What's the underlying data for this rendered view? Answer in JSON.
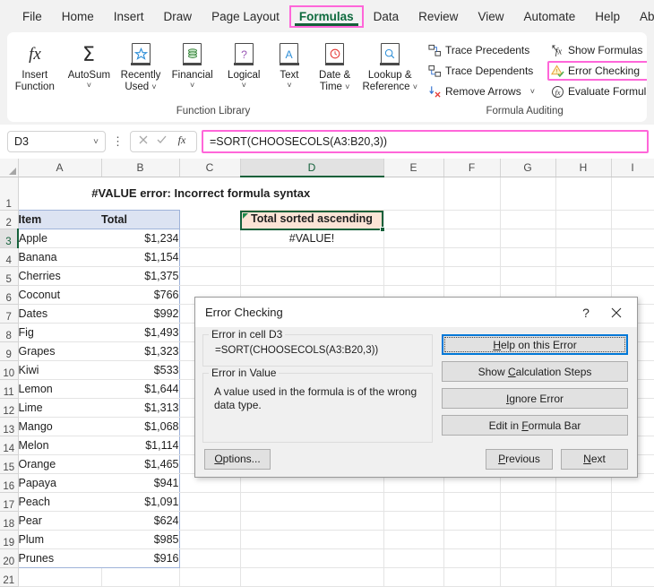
{
  "ribbon": {
    "tabs": [
      {
        "label": "File",
        "active": false
      },
      {
        "label": "Home",
        "active": false
      },
      {
        "label": "Insert",
        "active": false
      },
      {
        "label": "Draw",
        "active": false
      },
      {
        "label": "Page Layout",
        "active": false
      },
      {
        "label": "Formulas",
        "active": true
      },
      {
        "label": "Data",
        "active": false
      },
      {
        "label": "Review",
        "active": false
      },
      {
        "label": "View",
        "active": false
      },
      {
        "label": "Automate",
        "active": false
      },
      {
        "label": "Help",
        "active": false
      },
      {
        "label": "Ablebits",
        "active": false
      }
    ],
    "groups": {
      "function_library": {
        "label": "Function Library",
        "buttons": [
          {
            "line1": "Insert",
            "line2": "Function",
            "icon": "fx-icon",
            "dropdown": false
          },
          {
            "line1": "AutoSum",
            "line2": "",
            "icon": "sigma-icon",
            "dropdown": true
          },
          {
            "line1": "Recently",
            "line2": "Used",
            "icon": "star-book-icon",
            "dropdown": true
          },
          {
            "line1": "Financial",
            "line2": "",
            "icon": "coins-book-icon",
            "dropdown": true
          },
          {
            "line1": "Logical",
            "line2": "",
            "icon": "question-book-icon",
            "dropdown": true
          },
          {
            "line1": "Text",
            "line2": "",
            "icon": "letter-a-book-icon",
            "dropdown": true
          },
          {
            "line1": "Date &",
            "line2": "Time",
            "icon": "clock-book-icon",
            "dropdown": true
          },
          {
            "line1": "Lookup &",
            "line2": "Reference",
            "icon": "magnifier-book-icon",
            "dropdown": true
          }
        ]
      },
      "formula_auditing": {
        "label": "Formula Auditing",
        "col1": [
          {
            "label": "Trace Precedents",
            "icon": "trace-precedents-icon",
            "dropdown": false,
            "highlight": false
          },
          {
            "label": "Trace Dependents",
            "icon": "trace-dependents-icon",
            "dropdown": false,
            "highlight": false
          },
          {
            "label": "Remove Arrows",
            "icon": "remove-arrows-icon",
            "dropdown": true,
            "highlight": false
          }
        ],
        "col2": [
          {
            "label": "Show Formulas",
            "icon": "show-formulas-icon",
            "dropdown": false,
            "highlight": false
          },
          {
            "label": "Error Checking",
            "icon": "error-checking-icon",
            "dropdown": true,
            "highlight": true
          },
          {
            "label": "Evaluate Formula",
            "icon": "evaluate-formula-icon",
            "dropdown": false,
            "highlight": false
          }
        ]
      }
    }
  },
  "formula_bar": {
    "name_box_value": "D3",
    "name_box_chevron": "chevron-down-icon",
    "cancel_icon": "cancel-x-icon",
    "enter_icon": "enter-check-icon",
    "function_icon": "fx-icon",
    "formula_value": "=SORT(CHOOSECOLS(A3:B20,3))"
  },
  "grid": {
    "columns": [
      "A",
      "B",
      "C",
      "D",
      "E",
      "F",
      "G",
      "H",
      "I"
    ],
    "selected_column": "D",
    "selected_row": 3,
    "rows": [
      "1",
      "2",
      "3",
      "4",
      "5",
      "6",
      "7",
      "8",
      "9",
      "10",
      "11",
      "12",
      "13",
      "14",
      "15",
      "16",
      "17",
      "18",
      "19",
      "20",
      "21"
    ],
    "title": "#VALUE error: Incorrect formula syntax",
    "headers": {
      "a": "Item",
      "b": "Total",
      "d": "Total sorted ascending"
    },
    "data": [
      {
        "row": "3",
        "item": "Apple",
        "total": "$1,234"
      },
      {
        "row": "4",
        "item": "Banana",
        "total": "$1,154"
      },
      {
        "row": "5",
        "item": "Cherries",
        "total": "$1,375"
      },
      {
        "row": "6",
        "item": "Coconut",
        "total": "$766"
      },
      {
        "row": "7",
        "item": "Dates",
        "total": "$992"
      },
      {
        "row": "8",
        "item": "Fig",
        "total": "$1,493"
      },
      {
        "row": "9",
        "item": "Grapes",
        "total": "$1,323"
      },
      {
        "row": "10",
        "item": "Kiwi",
        "total": "$533"
      },
      {
        "row": "11",
        "item": "Lemon",
        "total": "$1,644"
      },
      {
        "row": "12",
        "item": "Lime",
        "total": "$1,313"
      },
      {
        "row": "13",
        "item": "Mango",
        "total": "$1,068"
      },
      {
        "row": "14",
        "item": "Melon",
        "total": "$1,114"
      },
      {
        "row": "15",
        "item": "Orange",
        "total": "$1,465"
      },
      {
        "row": "16",
        "item": "Papaya",
        "total": "$941"
      },
      {
        "row": "17",
        "item": "Peach",
        "total": "$1,091"
      },
      {
        "row": "18",
        "item": "Pear",
        "total": "$624"
      },
      {
        "row": "19",
        "item": "Plum",
        "total": "$985"
      },
      {
        "row": "20",
        "item": "Prunes",
        "total": "$916"
      }
    ],
    "selected_cell_value": "#VALUE!"
  },
  "dialog": {
    "title": "Error Checking",
    "help_icon": "?",
    "close_icon": "close-x-icon",
    "error_cell_legend": "Error in cell D3",
    "error_formula": "=SORT(CHOOSECOLS(A3:B20,3))",
    "error_value_legend": "Error in Value",
    "error_description": "A value used in the formula is of the wrong data type.",
    "buttons": [
      {
        "label": "Help on this Error",
        "focused": true
      },
      {
        "label": "Show Calculation Steps",
        "focused": false
      },
      {
        "label": "Ignore Error",
        "focused": false
      },
      {
        "label": "Edit in Formula Bar",
        "focused": false
      }
    ],
    "footer": {
      "options": "Options...",
      "previous": "Previous",
      "next": "Next"
    }
  },
  "colors": {
    "accent_green": "#14603a",
    "highlight_pink": "#ff66d9",
    "header_blue": "#dce3f2",
    "header_peach": "#fce4d6",
    "focus_blue": "#0078d7"
  }
}
